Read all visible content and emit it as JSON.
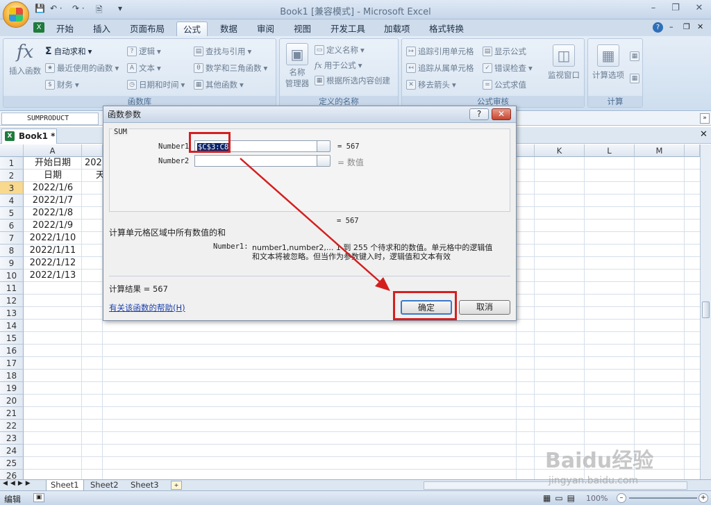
{
  "window": {
    "title": "Book1  [兼容模式] - Microsoft Excel",
    "qat": [
      "💾",
      "↶ ·",
      "↷ ·",
      "🖹",
      "▾"
    ]
  },
  "tabs": [
    "开始",
    "插入",
    "页面布局",
    "公式",
    "数据",
    "审阅",
    "视图",
    "开发工具",
    "加载项",
    "格式转换"
  ],
  "ribbon": {
    "library": {
      "label": "函数库",
      "insert_function": "插入函数",
      "items": [
        "自动求和",
        "最近使用的函数",
        "财务",
        "逻辑",
        "文本",
        "日期和时间",
        "查找与引用",
        "数学和三角函数",
        "其他函数"
      ]
    },
    "names": {
      "label": "定义的名称",
      "name_manager": [
        "名称",
        "管理器"
      ],
      "items": [
        "定义名称",
        "用于公式",
        "根据所选内容创建"
      ]
    },
    "audit": {
      "label": "公式审核",
      "items": [
        "追踪引用单元格",
        "追踪从属单元格",
        "移去箭头",
        "显示公式",
        "错误检查",
        "公式求值"
      ],
      "watch": "监视窗口"
    },
    "calc": {
      "label": "计算",
      "options": "计算选项"
    }
  },
  "formula_bar": {
    "name_box": "SUMPRODUCT"
  },
  "workbook_tab": "Book1 *",
  "columns": [
    "A",
    "K",
    "L",
    "M"
  ],
  "rows": [
    "1",
    "2",
    "3",
    "4",
    "5",
    "6",
    "7",
    "8",
    "9",
    "10",
    "11",
    "12",
    "13",
    "14",
    "15",
    "16",
    "17",
    "18",
    "19",
    "20",
    "21",
    "22",
    "23",
    "24",
    "25",
    "26"
  ],
  "cells_a": [
    "开始日期",
    "日期",
    "2022/1/6",
    "2022/1/7",
    "2022/1/8",
    "2022/1/9",
    "2022/1/10",
    "2022/1/11",
    "2022/1/12",
    "2022/1/13"
  ],
  "cells_b": [
    "202",
    "天"
  ],
  "dialog": {
    "title": "函数参数",
    "function_name": "SUM",
    "arg1_label": "Number1",
    "arg1_value": "$C$3:C8",
    "arg1_result": "= 567",
    "arg2_label": "Number2",
    "arg2_placeholder": "= 数值",
    "total_result": "= 567",
    "description": "计算单元格区域中所有数值的和",
    "param_name": "Number1:",
    "param_desc1": "number1,number2,... 1 到 255 个待求和的数值。单元格中的逻辑值",
    "param_desc2": "和文本将被忽略。但当作为参数键入时，逻辑值和文本有效",
    "calc_result": "计算结果 =  567",
    "help_link": "有关该函数的帮助(H)",
    "ok": "确定",
    "cancel": "取消"
  },
  "sheets": [
    "Sheet1",
    "Sheet2",
    "Sheet3"
  ],
  "status": {
    "mode": "编辑",
    "zoom": "100%"
  },
  "watermark": {
    "logo": "Baidu经验",
    "url": "jingyan.baidu.com"
  }
}
